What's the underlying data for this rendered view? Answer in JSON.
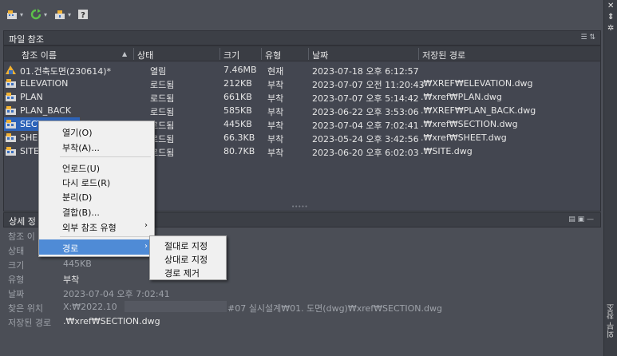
{
  "toolbar": {
    "buttons": [
      {
        "name": "attach-icon",
        "dropdown": true
      },
      {
        "name": "refresh-icon",
        "dropdown": true
      },
      {
        "name": "change-path-icon",
        "dropdown": true
      },
      {
        "name": "help-icon",
        "dropdown": false
      }
    ]
  },
  "right_strip": {
    "close_glyph": "✕",
    "pin_glyph": "⇕",
    "settings_glyph": "✲",
    "vertical_title": "외부 참조"
  },
  "file_panel": {
    "title": "파일 참조",
    "tools": "☰ ⇅",
    "columns": [
      "참조 이름",
      "상태",
      "크기",
      "유형",
      "날짜",
      "저장된 경로"
    ],
    "rows": [
      {
        "name": "01.건축도면(230614)*",
        "status": "열림",
        "size": "7.46MB",
        "type": "현재",
        "date": "2023-07-18 오후 6:12:57",
        "path": "",
        "icon": "dwg-master-icon"
      },
      {
        "name": "ELEVATION",
        "status": "로드됨",
        "size": "212KB",
        "type": "부착",
        "date": "2023-07-07 오전 11:20:43",
        "path": ".₩XREF₩ELEVATION.dwg",
        "icon": "dwg-xref-icon"
      },
      {
        "name": "PLAN",
        "status": "로드됨",
        "size": "661KB",
        "type": "부착",
        "date": "2023-07-07 오후 5:14:42",
        "path": ".₩xref₩PLAN.dwg",
        "icon": "dwg-xref-icon"
      },
      {
        "name": "PLAN_BACK",
        "status": "로드됨",
        "size": "585KB",
        "type": "부착",
        "date": "2023-06-22 오후 3:53:06",
        "path": ".₩XREF₩PLAN_BACK.dwg",
        "icon": "dwg-xref-icon"
      },
      {
        "name": "SECTION",
        "status": "로드됨",
        "size": "445KB",
        "type": "부착",
        "date": "2023-07-04 오후 7:02:41",
        "path": ".₩xref₩SECTION.dwg",
        "icon": "dwg-xref-icon",
        "selected": true
      },
      {
        "name": "SHEET",
        "status": "로드됨",
        "size": "66.3KB",
        "type": "부착",
        "date": "2023-05-24 오후 3:42:56",
        "path": ".₩xref₩SHEET.dwg",
        "icon": "dwg-xref-icon"
      },
      {
        "name": "SITE",
        "status": "로드됨",
        "size": "80.7KB",
        "type": "부착",
        "date": "2023-06-20 오후 6:02:03",
        "path": ".₩SITE.dwg",
        "icon": "dwg-xref-icon"
      }
    ]
  },
  "details_panel": {
    "title": "상세 정",
    "tools": "▤ ▣ —",
    "fields": [
      {
        "label": "참조 이",
        "value": ""
      },
      {
        "label": "상태",
        "value": ""
      },
      {
        "label": "크기",
        "value": "445KB"
      },
      {
        "label": "유형",
        "value": "부착"
      },
      {
        "label": "날짜",
        "value": "2023-07-04 오후 7:02:41"
      },
      {
        "label": "찾은 위치",
        "value": "X:₩2022.10",
        "value_tail": "#07 실시설계₩01. 도면(dwg)₩xref₩SECTION.dwg"
      },
      {
        "label": "저장된 경로",
        "value": ".₩xref₩SECTION.dwg"
      }
    ]
  },
  "context_menu": {
    "items": [
      "열기(O)",
      "부착(A)...",
      "언로드(U)",
      "다시 로드(R)",
      "분리(D)",
      "결합(B)...",
      "외부 참조 유형",
      "경로"
    ],
    "highlighted": "경로"
  },
  "path_submenu": {
    "items": [
      "절대로 지정",
      "상대로 지정",
      "경로 제거"
    ]
  },
  "colors": {
    "background": "#4b4e56",
    "selection": "#2d63b8",
    "menu_highlight": "#4f8bd6",
    "menu_bg": "#f0f0f0"
  }
}
